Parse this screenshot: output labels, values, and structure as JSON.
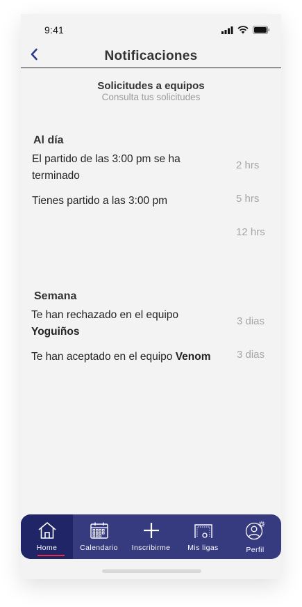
{
  "status_bar": {
    "time": "9:41"
  },
  "header": {
    "title": "Notificaciones"
  },
  "requests": {
    "title": "Solicitudes a equipos",
    "subtitle": "Consulta tus solicitudes"
  },
  "sections": {
    "today": {
      "title": "Al día",
      "items": [
        {
          "text": "El partido de las 3:00 pm se ha terminado",
          "time": "2 hrs"
        },
        {
          "text": "Tienes partido a las 3:00 pm",
          "time": "5 hrs"
        },
        {
          "text": "",
          "time": "12 hrs"
        }
      ]
    },
    "week": {
      "title": "Semana",
      "items": [
        {
          "text": "Te han rechazado en el equipo ",
          "bold": "Yoguiños",
          "time": "3 dias"
        },
        {
          "text": "Te han aceptado en el equipo ",
          "bold": "Venom",
          "time": "3 dias"
        }
      ]
    }
  },
  "tab_bar": {
    "tabs": [
      {
        "label": "Home",
        "icon": "home-icon",
        "active": true
      },
      {
        "label": "Calendario",
        "icon": "calendar-icon"
      },
      {
        "label": "Inscribirme",
        "icon": "plus-icon"
      },
      {
        "label": "Mis ligas",
        "icon": "goal-icon"
      },
      {
        "label": "Perfil",
        "icon": "profile-settings-icon"
      }
    ]
  },
  "colors": {
    "tab_bar": "#363a7f",
    "tab_active": "#1f2566",
    "accent_underline": "#e0304a",
    "back_arrow": "#2b3a8c"
  }
}
